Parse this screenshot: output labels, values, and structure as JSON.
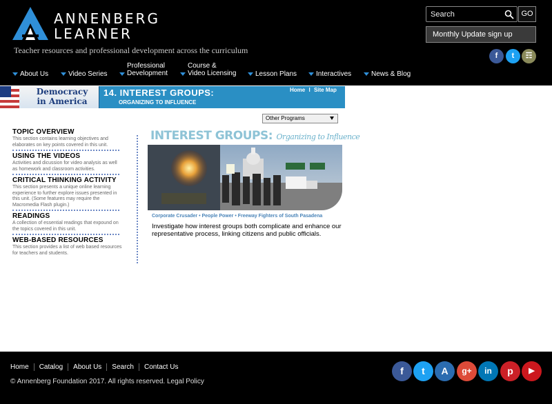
{
  "brand": {
    "name_line1": "ANNENBERG",
    "name_line2": "LEARNER",
    "tagline": "Teacher resources and professional development across the curriculum"
  },
  "search": {
    "placeholder": "Search",
    "go_label": "GO"
  },
  "monthly_update": "Monthly Update sign up",
  "header_social": [
    {
      "icon": "facebook-icon",
      "glyph": "f",
      "color": "#3b5998"
    },
    {
      "icon": "twitter-icon",
      "glyph": "t",
      "color": "#1da1f2"
    },
    {
      "icon": "cart-icon",
      "glyph": "☶",
      "color": "#8a8a5a"
    }
  ],
  "nav": [
    {
      "line1": "About Us",
      "line2": ""
    },
    {
      "line1": "Video Series",
      "line2": ""
    },
    {
      "line1": "Professional",
      "line2": "Development"
    },
    {
      "line1": "Course &",
      "line2": "Video Licensing"
    },
    {
      "line1": "Lesson Plans",
      "line2": ""
    },
    {
      "line1": "Interactives",
      "line2": ""
    },
    {
      "line1": "News & Blog",
      "line2": ""
    }
  ],
  "banner": {
    "program_line1": "Democracy",
    "program_line2": "in America",
    "title": "14. INTEREST GROUPS:",
    "subtitle": "ORGANIZING TO INFLUENCE",
    "home_link": "Home",
    "separator": "l",
    "sitemap_link": "Site Map"
  },
  "other_programs": "Other Programs",
  "topics": [
    {
      "title": "TOPIC OVERVIEW",
      "desc": "This section contains learning objectives and elaborates on key points covered in this unit."
    },
    {
      "title": "USING THE VIDEOS",
      "desc": "Activities and dicussion for video analysis as well as homework and classroom activities."
    },
    {
      "title": "CRITICAL THINKING ACTIVITY",
      "desc": "This section presents a unique online learning experience to further explore issues presented in this unit. (Some features may require the Macromedia Flash plugin.)"
    },
    {
      "title": "READINGS",
      "desc": "A collection of essential readings that expound on the topics covered in this unit."
    },
    {
      "title": "WEB-BASED RESOURCES",
      "desc": "This section provides a list of web based resources for teachers and students."
    }
  ],
  "main": {
    "title": "INTEREST GROUPS:",
    "title_sub": "Organizing to Influence",
    "captions": "Corporate Crusader  •  People Power  •  Freeway Fighters of South Pasadena",
    "description": "Investigate how interest groups both complicate and enhance our representative process, linking citizens and public officials."
  },
  "footer": {
    "links": [
      "Home",
      "Catalog",
      "About Us",
      "Search",
      "Contact Us"
    ],
    "copyright": "© Annenberg Foundation 2017. All rights reserved. Legal Policy"
  },
  "footer_social": [
    {
      "icon": "facebook-icon",
      "glyph": "f",
      "color": "#3b5998"
    },
    {
      "icon": "twitter-icon",
      "glyph": "t",
      "color": "#1da1f2"
    },
    {
      "icon": "annenberg-icon",
      "glyph": "A",
      "color": "#2b6cb0"
    },
    {
      "icon": "google-plus-icon",
      "glyph": "g+",
      "color": "#dd4b39"
    },
    {
      "icon": "linkedin-icon",
      "glyph": "in",
      "color": "#0077b5"
    },
    {
      "icon": "pinterest-icon",
      "glyph": "p",
      "color": "#cb2027"
    },
    {
      "icon": "youtube-icon",
      "glyph": "▶",
      "color": "#cc181e"
    }
  ]
}
